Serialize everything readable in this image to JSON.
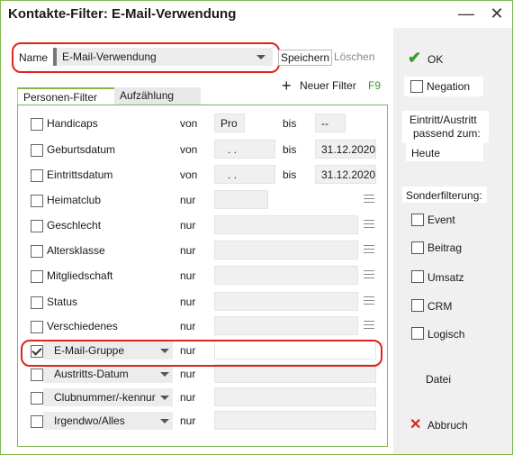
{
  "window": {
    "title": "Kontakte-Filter: E-Mail-Verwendung"
  },
  "titlebar": {
    "minimize": "—",
    "close": "✕"
  },
  "name_field": {
    "label": "Name",
    "value": "E-Mail-Verwendung"
  },
  "actions": {
    "save": "Speichern",
    "delete": "Löschen",
    "new_filter": "Neuer Filter",
    "new_filter_key": "F9"
  },
  "tabs": [
    {
      "label": "Personen-Filter"
    },
    {
      "label": "Aufzählung"
    }
  ],
  "rows": [
    {
      "label": "Handicaps",
      "op": "von",
      "from": "Pro",
      "bis": "bis",
      "to": "--",
      "checked": false
    },
    {
      "label": "Geburtsdatum",
      "op": "von",
      "from": ". .",
      "bis": "bis",
      "to": "31.12.2020",
      "checked": false
    },
    {
      "label": "Eintrittsdatum",
      "op": "von",
      "from": ". .",
      "bis": "bis",
      "to": "31.12.2020",
      "checked": false
    },
    {
      "label": "Heimatclub",
      "op": "nur",
      "checked": false
    },
    {
      "label": "Geschlecht",
      "op": "nur",
      "checked": false
    },
    {
      "label": "Altersklasse",
      "op": "nur",
      "checked": false
    },
    {
      "label": "Mitgliedschaft",
      "op": "nur",
      "checked": false
    },
    {
      "label": "Status",
      "op": "nur",
      "checked": false
    },
    {
      "label": "Verschiedenes",
      "op": "nur",
      "checked": false
    },
    {
      "label": "E-Mail-Gruppe",
      "op": "nur",
      "checked": true
    },
    {
      "label": "Austritts-Datum",
      "op": "nur",
      "checked": false
    },
    {
      "label": "Clubnummer/-kennur",
      "op": "nur",
      "checked": false
    },
    {
      "label": "Irgendwo/Alles",
      "op": "nur",
      "checked": false
    }
  ],
  "right": {
    "ok": "OK",
    "negation": "Negation",
    "eintritt_label_1": "Eintritt/Austritt",
    "eintritt_label_2": "passend zum:",
    "eintritt_value": "Heute",
    "sonder_label": "Sonderfilterung:",
    "event": "Event",
    "beitrag": "Beitrag",
    "umsatz": "Umsatz",
    "crm": "CRM",
    "logisch": "Logisch",
    "datei": "Datei",
    "abbruch": "Abbruch"
  },
  "colors": {
    "accent_green": "#7fb84f",
    "highlight_red": "#e2231a",
    "ok_green": "#3a9a2e",
    "cancel_red": "#d9261c"
  }
}
